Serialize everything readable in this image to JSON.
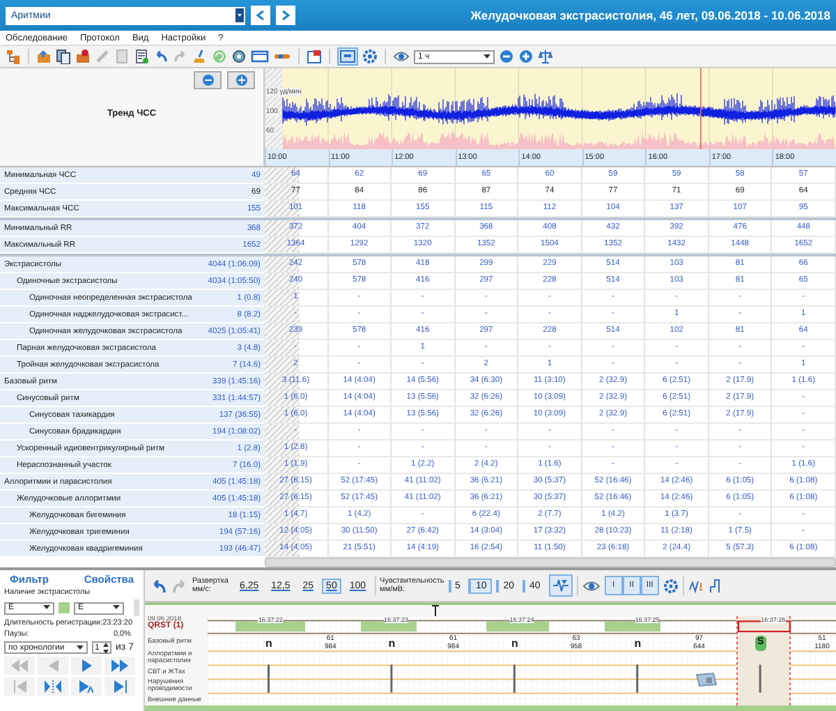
{
  "header": {
    "exam_select": "Аритмии",
    "title": "Желудочковая экстрасистолия, 46 лет, 09.06.2018 - 10.06.2018"
  },
  "menu": [
    "Обследование",
    "Протокол",
    "Вид",
    "Настройки",
    "?"
  ],
  "toolbar": {
    "period": "1 ч"
  },
  "trend": {
    "title": "Тренд ЧСС",
    "y_labels": [
      "120 уд/мин",
      "100",
      "60"
    ],
    "time_labels": [
      "10:00",
      "11:00",
      "12:00",
      "13:00",
      "14:00",
      "15:00",
      "16:00",
      "17:00",
      "18:00"
    ]
  },
  "table": {
    "sections": [
      {
        "rows": [
          {
            "label": "Минимальная ЧСС",
            "total": "49",
            "linked": true,
            "values": [
              "64",
              "62",
              "69",
              "65",
              "60",
              "59",
              "59",
              "58",
              "57"
            ]
          },
          {
            "label": "Средняя ЧСС",
            "total": "69",
            "linked": false,
            "values": [
              "77",
              "84",
              "86",
              "87",
              "74",
              "77",
              "71",
              "69",
              "64"
            ]
          },
          {
            "label": "Максимальная ЧСС",
            "total": "155",
            "linked": true,
            "values": [
              "101",
              "118",
              "155",
              "115",
              "112",
              "104",
              "137",
              "107",
              "95"
            ]
          }
        ]
      },
      {
        "rows": [
          {
            "label": "Минимальный RR",
            "total": "368",
            "linked": true,
            "values": [
              "372",
              "404",
              "372",
              "368",
              "408",
              "432",
              "392",
              "476",
              "448"
            ]
          },
          {
            "label": "Максимальный RR",
            "total": "1652",
            "linked": true,
            "values": [
              "1364",
              "1292",
              "1320",
              "1352",
              "1504",
              "1352",
              "1432",
              "1448",
              "1652"
            ]
          }
        ]
      },
      {
        "rows": [
          {
            "label": "Экстрасистолы",
            "total": "4044 (1:06:09)",
            "linked": true,
            "values": [
              "242",
              "578",
              "418",
              "299",
              "229",
              "514",
              "103",
              "81",
              "66"
            ],
            "children": [
              {
                "label": "Одиночные экстрасистолы",
                "total": "4034 (1:05:50)",
                "linked": true,
                "values": [
                  "240",
                  "578",
                  "416",
                  "297",
                  "228",
                  "514",
                  "103",
                  "81",
                  "65"
                ],
                "children": [
                  {
                    "label": "Одиночная неопределенная экстрасистола",
                    "total": "1 (0.8)",
                    "linked": true,
                    "values": [
                      "1",
                      "-",
                      "-",
                      "-",
                      "-",
                      "-",
                      "-",
                      "-",
                      "-"
                    ]
                  },
                  {
                    "label": "Одиночная наджелудочковая экстрасист...",
                    "total": "8 (8.2)",
                    "linked": true,
                    "values": [
                      "-",
                      "-",
                      "-",
                      "-",
                      "-",
                      "-",
                      "1",
                      "-",
                      "1"
                    ]
                  },
                  {
                    "label": "Одиночная желудочковая экстрасистола",
                    "total": "4025 (1:05:41)",
                    "linked": true,
                    "values": [
                      "239",
                      "578",
                      "416",
                      "297",
                      "228",
                      "514",
                      "102",
                      "81",
                      "64"
                    ]
                  }
                ]
              },
              {
                "label": "Парная желудочковая экстрасистола",
                "total": "3 (4.8)",
                "linked": true,
                "values": [
                  "-",
                  "-",
                  "1",
                  "-",
                  "-",
                  "-",
                  "-",
                  "-",
                  "-"
                ]
              },
              {
                "label": "Тройная желудочковая экстрасистола",
                "total": "7 (14.6)",
                "linked": true,
                "values": [
                  "2",
                  "-",
                  "-",
                  "2",
                  "1",
                  "-",
                  "-",
                  "-",
                  "1"
                ]
              }
            ]
          },
          {
            "label": "Базовый ритм",
            "total": "339 (1:45:16)",
            "linked": true,
            "values": [
              "3 (11.6)",
              "14 (4:04)",
              "14 (5:56)",
              "34 (6:30)",
              "11 (3:10)",
              "2 (32.9)",
              "6 (2:51)",
              "2 (17.9)",
              "1 (1.6)"
            ],
            "children": [
              {
                "label": "Синусовый ритм",
                "total": "331 (1:44:57)",
                "linked": true,
                "values": [
                  "1 (6.0)",
                  "14 (4:04)",
                  "13 (5:56)",
                  "32 (6:26)",
                  "10 (3:09)",
                  "2 (32.9)",
                  "6 (2:51)",
                  "2 (17.9)",
                  "-"
                ],
                "children": [
                  {
                    "label": "Синусовая тахикардия",
                    "total": "137 (36:55)",
                    "linked": true,
                    "values": [
                      "1 (6.0)",
                      "14 (4:04)",
                      "13 (5:56)",
                      "32 (6:26)",
                      "10 (3:09)",
                      "2 (32.9)",
                      "6 (2:51)",
                      "2 (17.9)",
                      "-"
                    ]
                  },
                  {
                    "label": "Синусовая брадикардия",
                    "total": "194 (1:08:02)",
                    "linked": true,
                    "values": [
                      "-",
                      "-",
                      "-",
                      "-",
                      "-",
                      "-",
                      "-",
                      "-",
                      "-"
                    ]
                  }
                ]
              },
              {
                "label": "Ускоренный идиовентрикулярный ритм",
                "total": "1 (2.8)",
                "linked": true,
                "values": [
                  "1 (2.8)",
                  "-",
                  "-",
                  "-",
                  "-",
                  "-",
                  "-",
                  "-",
                  "-"
                ]
              },
              {
                "label": "Нераспознанный участок",
                "total": "7 (16.0)",
                "linked": true,
                "values": [
                  "1 (1.9)",
                  "-",
                  "1 (2.2)",
                  "2 (4.2)",
                  "1 (1.6)",
                  "-",
                  "-",
                  "-",
                  "1 (1.6)"
                ]
              }
            ]
          },
          {
            "label": "Аллоритмии и парасистолия",
            "total": "405 (1:45:18)",
            "linked": true,
            "values": [
              "27 (6:15)",
              "52 (17:45)",
              "41 (11:02)",
              "36 (6:21)",
              "30 (5:37)",
              "52 (16:46)",
              "14 (2:46)",
              "6 (1:05)",
              "6 (1:08)"
            ],
            "children": [
              {
                "label": "Желудочковые аллоритмии",
                "total": "405 (1:45:18)",
                "linked": true,
                "values": [
                  "27 (6:15)",
                  "52 (17:45)",
                  "41 (11:02)",
                  "36 (6:21)",
                  "30 (5:37)",
                  "52 (16:46)",
                  "14 (2:46)",
                  "6 (1:05)",
                  "6 (1:08)"
                ],
                "children": [
                  {
                    "label": "Желудочковая бигеминия",
                    "total": "18 (1:15)",
                    "linked": true,
                    "values": [
                      "1 (4.7)",
                      "1 (4.2)",
                      "-",
                      "6 (22.4)",
                      "2 (7.7)",
                      "1 (4.2)",
                      "1 (3.7)",
                      "-",
                      "-"
                    ]
                  },
                  {
                    "label": "Желудочковая тригеминия",
                    "total": "194 (57:16)",
                    "linked": true,
                    "values": [
                      "12 (4:05)",
                      "30 (11:50)",
                      "27 (6:42)",
                      "14 (3:04)",
                      "17 (3:32)",
                      "28 (10:23)",
                      "11 (2:18)",
                      "1 (7.5)",
                      "-"
                    ]
                  },
                  {
                    "label": "Желудочковая квадригеминия",
                    "total": "193 (46:47)",
                    "linked": true,
                    "values": [
                      "14 (4:05)",
                      "21 (5:51)",
                      "14 (4:19)",
                      "16 (2:54)",
                      "11 (1:50)",
                      "23 (6:18)",
                      "2 (24.4)",
                      "5 (57.3)",
                      "6 (1:08)"
                    ]
                  }
                ]
              }
            ]
          }
        ]
      }
    ]
  },
  "filter_panel": {
    "tabs": [
      "Фильтр",
      "Свойства"
    ],
    "filter_label": "Наличие экстрасистолы",
    "select_1": "E",
    "select_2": "E",
    "duration_label": "Длительность регистрации:",
    "duration": "23:23:20",
    "pauses_label": "Паузы:",
    "pauses": "0,0%",
    "order": "по хронологии",
    "page": "1",
    "page_total": "из 7"
  },
  "ecg_toolbar": {
    "sweep_label": "Развертка мм/с:",
    "sweeps": [
      {
        "label": "6,25",
        "selected": false
      },
      {
        "label": "12,5",
        "selected": false
      },
      {
        "label": "25",
        "selected": false
      },
      {
        "label": "50",
        "selected": true
      },
      {
        "label": "100",
        "selected": false
      }
    ],
    "sensitivity_label": "Чувствительность мм/мВ:",
    "sensitivities": [
      {
        "label": "5",
        "selected": false
      },
      {
        "label": "10",
        "selected": true
      },
      {
        "label": "20",
        "selected": false
      },
      {
        "label": "40",
        "selected": false
      }
    ],
    "leads": [
      {
        "label": "I",
        "selected": true
      },
      {
        "label": "II",
        "selected": true
      },
      {
        "label": "III",
        "selected": true
      }
    ]
  },
  "strip": {
    "date": "09.06.2018",
    "channels": [
      "QRST (1)",
      "Базовый ритм",
      "Аллоритмии и парасистолия",
      "СВТ и ЖТах",
      "Нарушения проводимости",
      "Внешние данные"
    ],
    "times": [
      "16:37:22",
      "16:37:23",
      "16:37:24",
      "16:37:25",
      "16:37:26"
    ],
    "beats": [
      {
        "kind": "marker",
        "label": "n"
      },
      {
        "kind": "interval",
        "rate": "61",
        "rr": "984"
      },
      {
        "kind": "marker",
        "label": "n"
      },
      {
        "kind": "interval",
        "rate": "61",
        "rr": "984"
      },
      {
        "kind": "marker",
        "label": "n"
      },
      {
        "kind": "interval",
        "rate": "63",
        "rr": "958"
      },
      {
        "kind": "marker",
        "label": "n"
      },
      {
        "kind": "interval",
        "rate": "97",
        "rr": "644"
      },
      {
        "kind": "ectopic",
        "label": "S"
      },
      {
        "kind": "interval",
        "rate": "51",
        "rr": "1180"
      }
    ]
  }
}
